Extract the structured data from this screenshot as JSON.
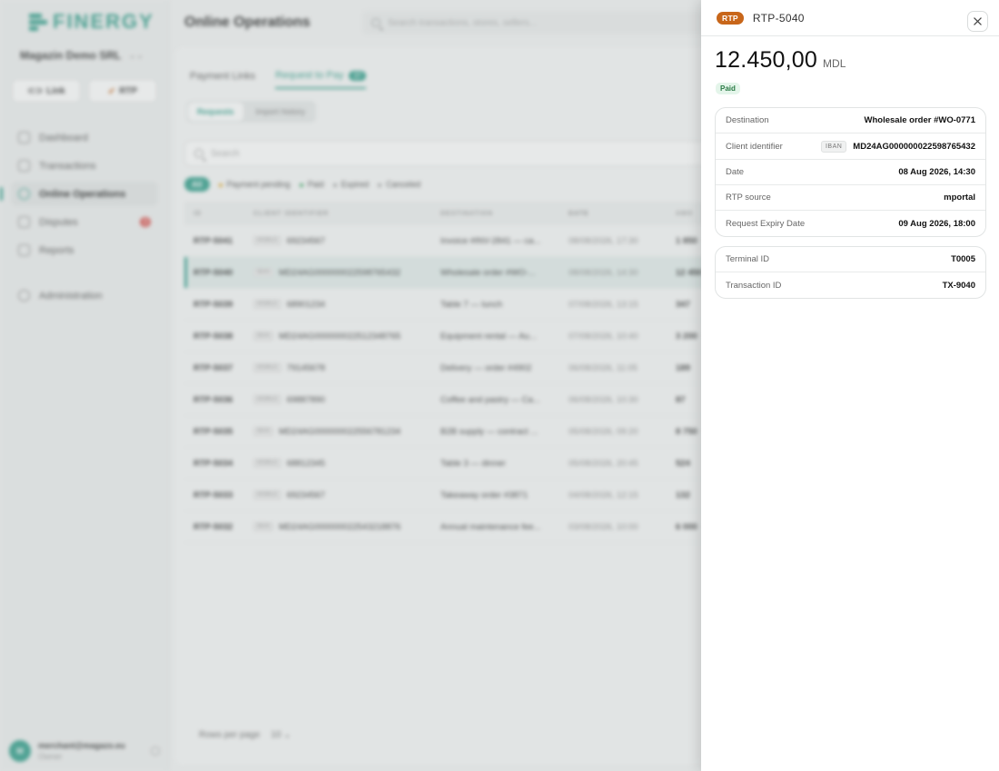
{
  "app": {
    "brand": "FINERGY",
    "merchant": "Magazin Demo SRL",
    "merchant_switch": "⌄⌄",
    "quick_actions": [
      {
        "label": "Link"
      },
      {
        "label": "RTP"
      }
    ],
    "nav": [
      {
        "label": "Dashboard"
      },
      {
        "label": "Transactions"
      },
      {
        "label": "Online Operations"
      },
      {
        "label": "Disputes",
        "badge": "3"
      },
      {
        "label": "Reports"
      },
      {
        "label": "Administration"
      }
    ],
    "user": {
      "initial": "M",
      "email": "merchant@magazo.eu",
      "role": "Owner"
    }
  },
  "main": {
    "title": "Online Operations",
    "search_placeholder": "Search transactions, stores, sellers...",
    "tabs": [
      {
        "label": "Payment Links"
      },
      {
        "label": "Request to Pay",
        "badge": "37"
      }
    ],
    "segments": [
      {
        "label": "Requests"
      },
      {
        "label": "Import history"
      }
    ],
    "table_search_placeholder": "Search",
    "filters": {
      "all": "All",
      "items": [
        {
          "label": "Payment pending",
          "color": "#e0a21b"
        },
        {
          "label": "Paid",
          "color": "#2f9e5a"
        },
        {
          "label": "Expired",
          "color": "#999999"
        },
        {
          "label": "Canceled",
          "color": "#999999"
        }
      ]
    },
    "columns": [
      "ID",
      "CLIENT IDENTIFIER",
      "DESTINATION",
      "DATE",
      "AMO"
    ],
    "rows": [
      {
        "id": "RTP-5041",
        "type": "MOBILE",
        "client": "69234567",
        "dest": "Invoice #INV-2841 — ca...",
        "date": "08/08/2026, 17:30",
        "amount": "1 850"
      },
      {
        "id": "RTP-5040",
        "type": "IBAN",
        "client": "MD24AG000000022598765432",
        "dest": "Wholesale order #WO-...",
        "date": "08/08/2026, 14:30",
        "amount": "12 450"
      },
      {
        "id": "RTP-5039",
        "type": "MOBILE",
        "client": "68901234",
        "dest": "Table 7 — lunch",
        "date": "07/08/2026, 13:15",
        "amount": "347"
      },
      {
        "id": "RTP-5038",
        "type": "IBAN",
        "client": "MD24AG000000022512348765",
        "dest": "Equipment rental — Au...",
        "date": "07/08/2026, 10:40",
        "amount": "3 200"
      },
      {
        "id": "RTP-5037",
        "type": "MOBILE",
        "client": "79145678",
        "dest": "Delivery — order #4902",
        "date": "06/08/2026, 11:05",
        "amount": "189"
      },
      {
        "id": "RTP-5036",
        "type": "MOBILE",
        "client": "69887890",
        "dest": "Coffee and pastry — Ca...",
        "date": "06/08/2026, 10:30",
        "amount": "87"
      },
      {
        "id": "RTP-5035",
        "type": "IBAN",
        "client": "MD24AG000000022556781234",
        "dest": "B2B supply — contract ...",
        "date": "05/08/2026, 09:20",
        "amount": "8 750"
      },
      {
        "id": "RTP-5034",
        "type": "MOBILE",
        "client": "68812345",
        "dest": "Table 3 — dinner",
        "date": "05/08/2026, 20:45",
        "amount": "524"
      },
      {
        "id": "RTP-5033",
        "type": "MOBILE",
        "client": "69234567",
        "dest": "Takeaway order #3871",
        "date": "04/08/2026, 12:15",
        "amount": "132"
      },
      {
        "id": "RTP-5032",
        "type": "IBAN",
        "client": "MD24AG000000022543218876",
        "dest": "Annual maintenance fee...",
        "date": "03/08/2026, 10:00",
        "amount": "6 000"
      }
    ],
    "footer": {
      "label": "Rows per page",
      "value": "10"
    }
  },
  "drawer": {
    "badge": "RTP",
    "id": "RTP-5040",
    "amount": "12.450,00",
    "currency": "MDL",
    "status": "Paid",
    "details": [
      {
        "label": "Destination",
        "value": "Wholesale order #WO-0771"
      },
      {
        "label": "Client identifier",
        "tag": "IBAN",
        "value": "MD24AG000000022598765432"
      },
      {
        "label": "Date",
        "value": "08 Aug 2026, 14:30"
      },
      {
        "label": "RTP source",
        "value": "mportal"
      },
      {
        "label": "Request Expiry Date",
        "value": "09 Aug 2026, 18:00"
      }
    ],
    "terminal": [
      {
        "label": "Terminal ID",
        "value": "T0005"
      },
      {
        "label": "Transaction ID",
        "value": "TX-9040"
      }
    ],
    "colors": {
      "badge": "#c8661a",
      "status_bg": "#e4f5ea",
      "accent": "#2f9e8a"
    }
  }
}
